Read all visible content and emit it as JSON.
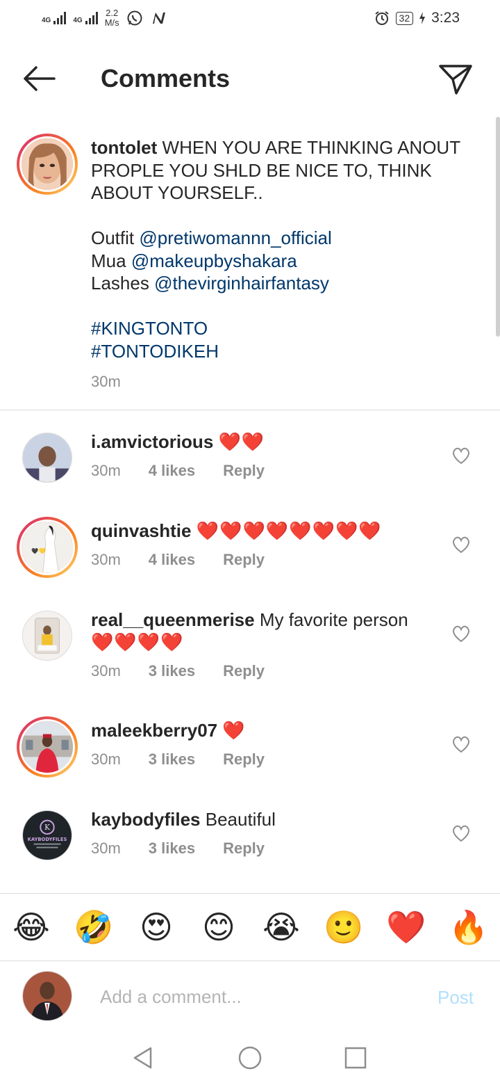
{
  "status_bar": {
    "network_1": "4G",
    "network_2": "4G",
    "speed_value": "2.2",
    "speed_unit": "M/s",
    "icons": [
      "whatsapp-icon",
      "n-app-icon",
      "alarm-icon",
      "charging-icon"
    ],
    "battery": "32",
    "time": "3:23"
  },
  "header": {
    "title": "Comments"
  },
  "caption": {
    "username": "tontolet",
    "text_line": " WHEN YOU ARE THINKING ANOUT PROPLE YOU SHLD BE NICE TO, THINK ABOUT YOURSELF..",
    "outfit_label": "Outfit ",
    "outfit_mention": "@pretiwomannn_official",
    "mua_label": "Mua ",
    "mua_mention": "@makeupbyshakara",
    "lashes_label": "Lashes ",
    "lashes_mention": "@thevirginhairfantasy",
    "hashtag_1": "#KINGTONTO",
    "hashtag_2": "#TONTODIKEH",
    "time": "30m"
  },
  "comments": [
    {
      "username": "i.amvictorious",
      "text": "",
      "hearts": "❤️❤️",
      "time": "30m",
      "likes": "4 likes",
      "reply": "Reply"
    },
    {
      "username": "quinvashtie",
      "text": "",
      "hearts": "❤️❤️❤️❤️❤️❤️❤️❤️",
      "time": "30m",
      "likes": "4 likes",
      "reply": "Reply"
    },
    {
      "username": "real__queenmerise",
      "text": " My favorite person",
      "hearts": "❤️❤️❤️❤️",
      "time": "30m",
      "likes": "3 likes",
      "reply": "Reply"
    },
    {
      "username": "maleekberry07",
      "text": "",
      "hearts": "❤️",
      "time": "30m",
      "likes": "3 likes",
      "reply": "Reply"
    },
    {
      "username": "kaybodyfiles",
      "text": " Beautiful",
      "hearts": "",
      "time": "30m",
      "likes": "3 likes",
      "reply": "Reply"
    }
  ],
  "avatar_texts": {
    "kaybodyfiles_logo": "KAYBODYFILES"
  },
  "emoji_bar": [
    "😂",
    "🤣",
    "😍",
    "😊",
    "😭",
    "🙂",
    "❤️",
    "🔥"
  ],
  "input": {
    "placeholder": "Add a comment...",
    "post_label": "Post"
  },
  "colors": {
    "link": "#00376b",
    "heart": "#e0202f",
    "meta_grey": "#8e8e8e",
    "post_disabled": "#b2dffc"
  }
}
